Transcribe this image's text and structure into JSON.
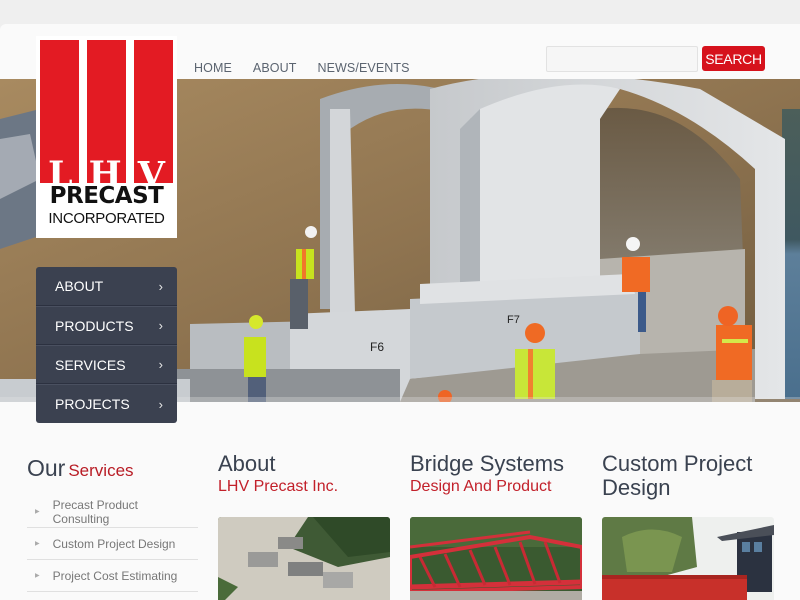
{
  "logo": {
    "letters": [
      "L",
      "H",
      "V"
    ],
    "line1": "PRECAST",
    "line2": "INCORPORATED",
    "brand_red": "#e31b23"
  },
  "topnav": {
    "items": [
      {
        "label": "HOME"
      },
      {
        "label": "ABOUT"
      },
      {
        "label": "NEWS/EVENTS"
      }
    ]
  },
  "search": {
    "value": "",
    "placeholder": "",
    "button_label": "SEARCH"
  },
  "sidemenu": {
    "items": [
      {
        "label": "ABOUT",
        "icon": "chevron-right-icon"
      },
      {
        "label": "PRODUCTS",
        "icon": "chevron-right-icon"
      },
      {
        "label": "SERVICES",
        "icon": "chevron-right-icon"
      },
      {
        "label": "PROJECTS",
        "icon": "chevron-right-icon"
      }
    ]
  },
  "hero": {
    "alt": "Workers installing precast concrete arch sections"
  },
  "services": {
    "title_dark": "Our",
    "title_red": "Services",
    "items": [
      {
        "label": "Precast Product Consulting"
      },
      {
        "label": "Custom Project Design"
      },
      {
        "label": "Project Cost Estimating"
      }
    ]
  },
  "columns": [
    {
      "title": "About",
      "subtitle": "LHV Precast Inc.",
      "image": "aerial-plant-photo"
    },
    {
      "title": "Bridge Systems",
      "subtitle": "Design And Product",
      "image": "red-truss-bridge-photo"
    },
    {
      "title": "Custom Project Design",
      "subtitle": "",
      "image": "building-photo"
    }
  ]
}
